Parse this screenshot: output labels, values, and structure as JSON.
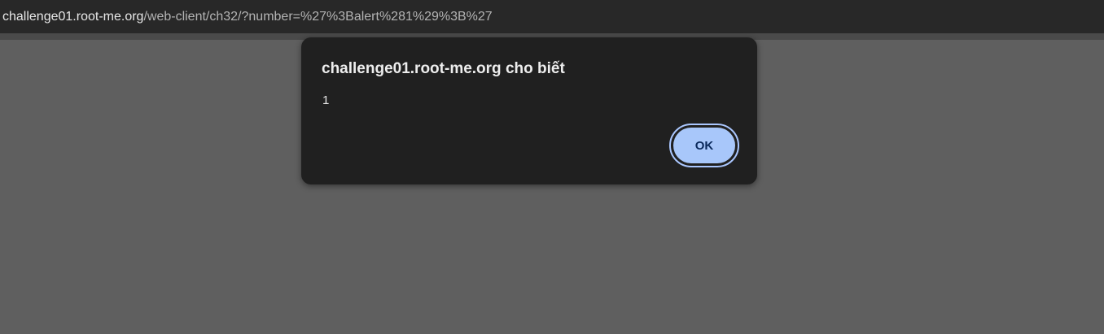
{
  "browser": {
    "url_host": "challenge01.root-me.org",
    "url_path": "/web-client/ch32/?number=%27%3Balert%281%29%3B%27"
  },
  "dialog": {
    "title": "challenge01.root-me.org cho biết",
    "message": "1",
    "ok_label": "OK"
  },
  "colors": {
    "page_background": "#5f5f5f",
    "address_bar": "#282828",
    "dialog_background": "#202020",
    "ok_button": "#a8c7fa",
    "focus_ring": "#aac7ff"
  }
}
